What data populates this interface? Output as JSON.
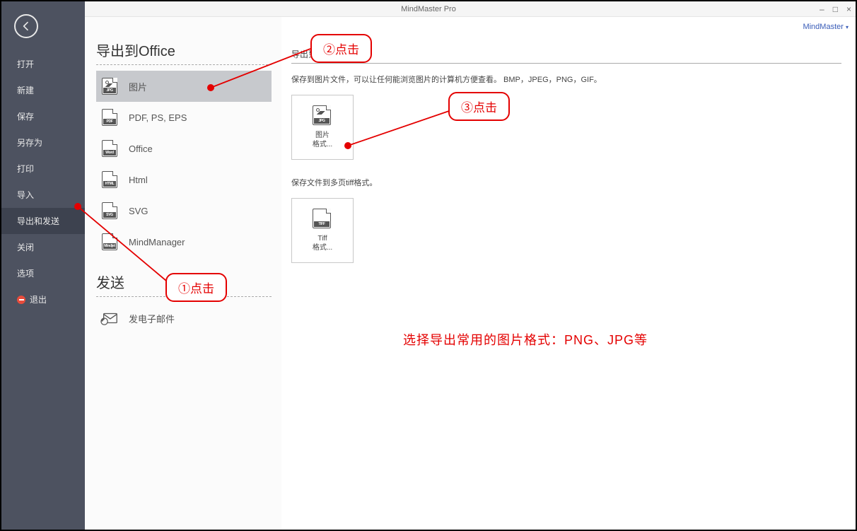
{
  "app": {
    "title": "MindMaster Pro",
    "brand": "MindMaster",
    "brand_arrow": "▾"
  },
  "sidebar": {
    "items": [
      {
        "label": "打开"
      },
      {
        "label": "新建"
      },
      {
        "label": "保存"
      },
      {
        "label": "另存为"
      },
      {
        "label": "打印"
      },
      {
        "label": "导入"
      },
      {
        "label": "导出和发送"
      },
      {
        "label": "关闭"
      },
      {
        "label": "选项"
      },
      {
        "label": "退出"
      }
    ]
  },
  "mid": {
    "section1_title": "导出到Office",
    "export_items": [
      {
        "label": "图片",
        "tag": "JPG"
      },
      {
        "label": "PDF, PS, EPS",
        "tag": "PDF"
      },
      {
        "label": "Office",
        "tag": "Word"
      },
      {
        "label": "Html",
        "tag": "HTML"
      },
      {
        "label": "SVG",
        "tag": "SVG"
      },
      {
        "label": "MindManager",
        "tag": "Mindjet"
      }
    ],
    "section2_title": "发送",
    "send_items": [
      {
        "label": "发电子邮件"
      }
    ]
  },
  "content": {
    "sub1": "导出到",
    "desc1": "保存到图片文件，可以让任何能浏览图片的计算机方便查看。 BMP，JPEG，PNG，GIF。",
    "tile1_tag": "JPG",
    "tile1_label1": "图片",
    "tile1_label2": "格式...",
    "desc2": "保存文件到多页tiff格式。",
    "tile2_tag": "TIFF",
    "tile2_label1": "Tiff",
    "tile2_label2": "格式..."
  },
  "callouts": {
    "c1": "①点击",
    "c2": "②点击",
    "c3": "③点击"
  },
  "hint": "选择导出常用的图片格式：PNG、JPG等"
}
